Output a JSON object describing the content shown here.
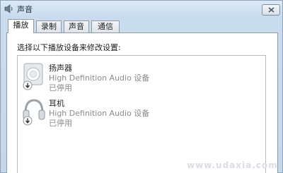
{
  "window": {
    "title": "声音",
    "title_icon": "speaker-icon",
    "close_icon": "close-icon"
  },
  "tabs": [
    {
      "label": "播放",
      "active": true
    },
    {
      "label": "录制",
      "active": false
    },
    {
      "label": "声音",
      "active": false
    },
    {
      "label": "通信",
      "active": false
    }
  ],
  "playback": {
    "instruction": "选择以下播放设备来修改设置:",
    "devices": [
      {
        "name": "扬声器",
        "description": "High Definition Audio 设备",
        "status": "已停用",
        "icon": "speaker-device-icon",
        "status_icon": "disabled-arrow-icon"
      },
      {
        "name": "耳机",
        "description": "High Definition Audio 设备",
        "status": "已停用",
        "icon": "headphones-icon",
        "status_icon": "disabled-arrow-icon"
      }
    ]
  },
  "watermark": "www.udaxia.com"
}
